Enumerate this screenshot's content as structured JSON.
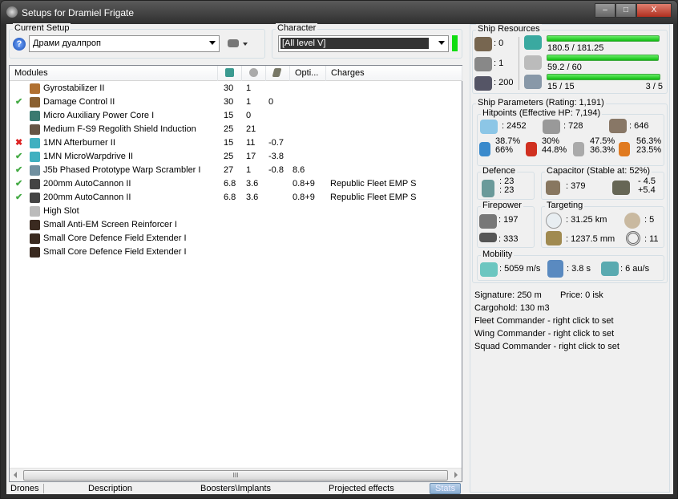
{
  "window": {
    "title": "Setups for Dramiel Frigate",
    "minimize": "–",
    "maximize": "□",
    "close": "X"
  },
  "current_setup": {
    "label": "Current Setup",
    "value": "Драми дуалпроп",
    "help_icon": "?"
  },
  "character": {
    "label": "Character",
    "value": "[All level V]"
  },
  "modules": {
    "headers": [
      "Modules",
      "",
      "",
      "",
      "Opti...",
      "Charges"
    ],
    "rows": [
      {
        "status": "",
        "name": "Gyrostabilizer II",
        "cpu": "30",
        "pg": "1",
        "cap": "",
        "opt": "",
        "charge": "",
        "color": "#b07030"
      },
      {
        "status": "ok",
        "name": "Damage Control II",
        "cpu": "30",
        "pg": "1",
        "cap": "0",
        "opt": "",
        "charge": "",
        "color": "#8a6030"
      },
      {
        "status": "",
        "name": "Micro Auxiliary Power Core I",
        "cpu": "15",
        "pg": "0",
        "cap": "",
        "opt": "",
        "charge": "",
        "color": "#3a7a70"
      },
      {
        "status": "",
        "name": "Medium F-S9 Regolith Shield Induction",
        "cpu": "25",
        "pg": "21",
        "cap": "",
        "opt": "",
        "charge": "",
        "color": "#665544"
      },
      {
        "status": "off",
        "name": "1MN Afterburner II",
        "cpu": "15",
        "pg": "11",
        "cap": "-0.7",
        "opt": "",
        "charge": "",
        "color": "#40b0c0"
      },
      {
        "status": "ok",
        "name": "1MN MicroWarpdrive II",
        "cpu": "25",
        "pg": "17",
        "cap": "-3.8",
        "opt": "",
        "charge": "",
        "color": "#40b0c0"
      },
      {
        "status": "ok",
        "name": "J5b Phased Prototype Warp Scrambler I",
        "cpu": "27",
        "pg": "1",
        "cap": "-0.8",
        "opt": "8.6",
        "charge": "",
        "color": "#7090a0"
      },
      {
        "status": "ok",
        "name": "200mm AutoCannon II",
        "cpu": "6.8",
        "pg": "3.6",
        "cap": "",
        "opt": "0.8+9",
        "charge": "Republic Fleet EMP S",
        "color": "#444"
      },
      {
        "status": "ok",
        "name": "200mm AutoCannon II",
        "cpu": "6.8",
        "pg": "3.6",
        "cap": "",
        "opt": "0.8+9",
        "charge": "Republic Fleet EMP S",
        "color": "#444"
      },
      {
        "status": "",
        "name": "High Slot",
        "cpu": "",
        "pg": "",
        "cap": "",
        "opt": "",
        "charge": "",
        "color": "#bbb"
      },
      {
        "status": "",
        "name": "Small Anti-EM Screen Reinforcer I",
        "cpu": "",
        "pg": "",
        "cap": "",
        "opt": "",
        "charge": "",
        "color": "#3a2a20"
      },
      {
        "status": "",
        "name": "Small Core Defence Field Extender I",
        "cpu": "",
        "pg": "",
        "cap": "",
        "opt": "",
        "charge": "",
        "color": "#3a2a20"
      },
      {
        "status": "",
        "name": "Small Core Defence Field Extender I",
        "cpu": "",
        "pg": "",
        "cap": "",
        "opt": "",
        "charge": "",
        "color": "#3a2a20"
      }
    ],
    "status_icons": {
      "ok": "✔",
      "off": "✖"
    },
    "scroll_grip": "III"
  },
  "tabs": [
    "Drones",
    "Description",
    "Boosters\\Implants",
    "Projected effects",
    "Stats"
  ],
  "resources": {
    "label": "Ship Resources",
    "turrets": ": 0",
    "launchers": ": 1",
    "drone_bay": ": 200",
    "cpu": "180.5 / 181.25",
    "cpu_pct": 99.6,
    "pg": "59.2 / 60",
    "pg_pct": 98.7,
    "calibration": "15 / 15",
    "calibration_pct": 100,
    "drones": "3 / 5"
  },
  "params": {
    "label": "Ship Parameters (Rating: 1,191)",
    "hp_label": "Hitpoints (Effective HP: 7,194)",
    "shield": ": 2452",
    "armor": ": 728",
    "structure": ": 646",
    "resists": [
      [
        "38.7%",
        "66%"
      ],
      [
        "30%",
        "44.8%"
      ],
      [
        "47.5%",
        "36.3%"
      ],
      [
        "56.3%",
        "23.5%"
      ]
    ],
    "defence_label": "Defence",
    "def1": ": 23",
    "def2": ": 23",
    "cap_label": "Capacitor (Stable at: 52%)",
    "cap": ": 379",
    "cap_use": "- 4.5",
    "cap_regen": "+5.4",
    "fire_label": "Firepower",
    "dps": ": 197",
    "volley": ": 333",
    "target_label": "Targeting",
    "range": ": 31.25 km",
    "max_targets": ": 5",
    "scan_res": ": 1237.5 mm",
    "sensor": ": 11",
    "mob_label": "Mobility",
    "speed": ": 5059 m/s",
    "align": ": 3.8 s",
    "warp": ": 6 au/s"
  },
  "info": {
    "signature": "Signature: 250 m",
    "price": "Price: 0 isk",
    "cargo": "Cargohold: 130 m3",
    "fleet": "Fleet Commander - right click to set",
    "wing": "Wing Commander - right click to set",
    "squad": "Squad Commander - right click to set"
  }
}
